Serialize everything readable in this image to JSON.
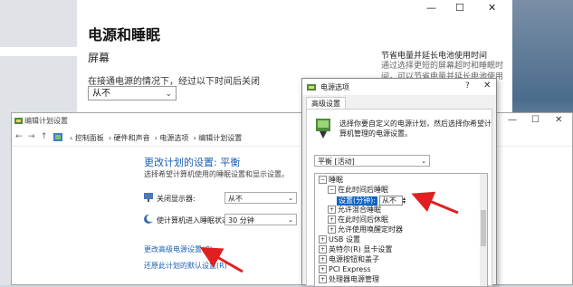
{
  "settings": {
    "title": "电源和睡眠",
    "section": "屏幕",
    "desc": "在接通电源的情况下，经过以下时间后关闭",
    "select_value": "从不",
    "right_heading": "节省电量并延长电池使用时间",
    "right_text": "通过选择更短的屏幕超时和睡眠时间，可以节省电量并延长电池使用时间。",
    "controls": {
      "minimize": "—",
      "maximize": "☐",
      "close": "✕"
    }
  },
  "edit_plan": {
    "window_title": "编辑计划设置",
    "controls": {
      "minimize": "—",
      "maximize": "☐",
      "close": "✕"
    },
    "breadcrumb": [
      "控制面板",
      "硬件和声音",
      "电源选项",
      "编辑计划设置"
    ],
    "heading": "更改计划的设置: 平衡",
    "sub": "选择希望计算机使用的睡眠设置和显示设置。",
    "display_label": "关闭显示器:",
    "display_value": "从不",
    "sleep_label": "使计算机进入睡眠状态:",
    "sleep_value": "30 分钟",
    "link_advanced": "更改高级电源设置(C)",
    "link_restore": "还原此计划的默认设置(R)"
  },
  "dialog": {
    "title": "电源选项",
    "help": "?",
    "close": "✕",
    "tab": "高级设置",
    "intro": "选择你要自定义的电源计划，然后选择你希望计算机管理的电源设置。",
    "plan_select": "平衡 [活动]",
    "tree": [
      {
        "expander": "⊟",
        "label": "睡眠",
        "level": 0
      },
      {
        "expander": "⊟",
        "label": "在此时间后睡眠",
        "level": 1
      },
      {
        "expander": "",
        "label": "设置(分钟):",
        "value": "从不",
        "level": 2,
        "selected": true
      },
      {
        "expander": "⊞",
        "label": "允许混合睡眠",
        "level": 1
      },
      {
        "expander": "⊞",
        "label": "在此时间后休眠",
        "level": 1
      },
      {
        "expander": "⊞",
        "label": "允许使用唤醒定时器",
        "level": 1
      },
      {
        "expander": "⊞",
        "label": "USB 设置",
        "level": 0
      },
      {
        "expander": "⊞",
        "label": "英特尔(R) 显卡设置",
        "level": 0
      },
      {
        "expander": "⊞",
        "label": "电源按钮和盖子",
        "level": 0
      },
      {
        "expander": "⊞",
        "label": "PCI Express",
        "level": 0
      },
      {
        "expander": "⊞",
        "label": "处理器电源管理",
        "level": 0
      }
    ]
  },
  "colors": {
    "link": "#1a5fb4",
    "arrow": "#e02020",
    "selection": "#0a64c8"
  }
}
